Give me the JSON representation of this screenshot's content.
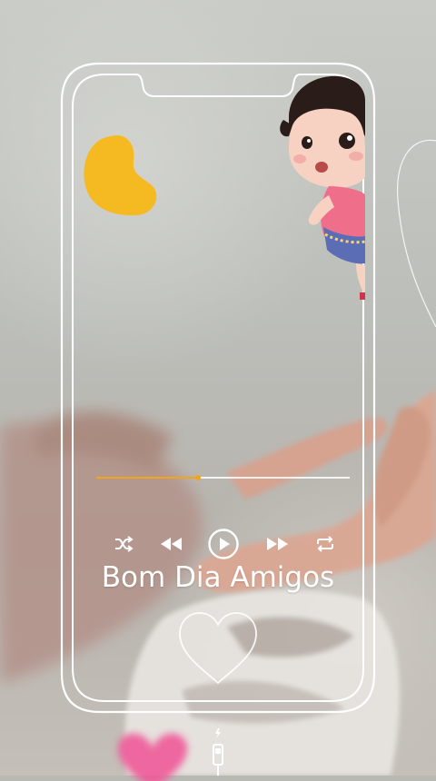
{
  "song": {
    "title": "Bom Dia Amigos"
  },
  "player": {
    "progress_fraction": 0.4,
    "controls": [
      {
        "name": "shuffle-button",
        "icon": "shuffle-icon"
      },
      {
        "name": "rewind-button",
        "icon": "rewind-icon"
      },
      {
        "name": "play-button",
        "icon": "play-icon"
      },
      {
        "name": "fast-forward-button",
        "icon": "fast-forward-icon"
      },
      {
        "name": "repeat-button",
        "icon": "repeat-icon"
      }
    ],
    "like_icon": "heart-outline-icon",
    "charging_icon": "charging-cable-icon"
  },
  "colors": {
    "accent": "#f2a51b",
    "frame": "#ffffff",
    "blob": "#f5b921"
  }
}
